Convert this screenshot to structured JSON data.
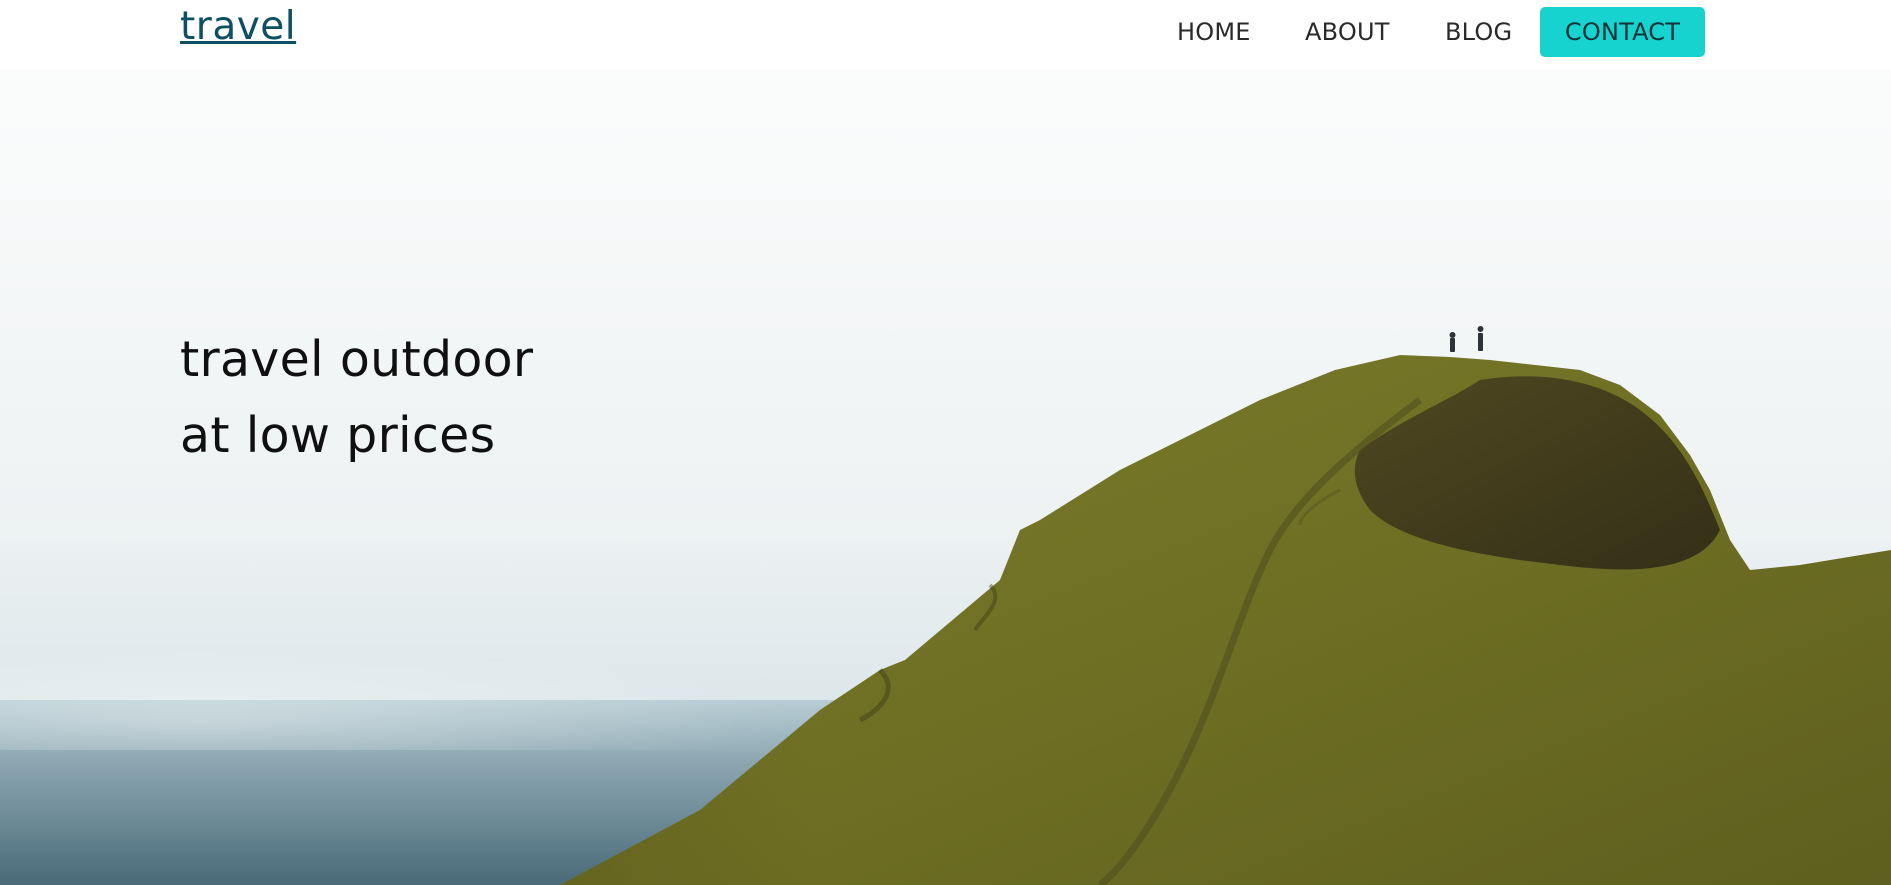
{
  "header": {
    "logo_text": "travel",
    "nav": {
      "home": "HOME",
      "about": "ABOUT",
      "blog": "BLOG",
      "contact": "CONTACT"
    }
  },
  "hero": {
    "headline_line1": "travel outdoor",
    "headline_line2": "at low prices",
    "image_description_name": "hero-landscape-image"
  },
  "colors": {
    "logo": "#0d4f63",
    "accent": "#17d3cf",
    "nav_text": "#2a2a2a",
    "headline": "#101010",
    "sky": "#f4f6f7",
    "sea": "#4f6f7c",
    "grass": "#7a7a2a"
  }
}
